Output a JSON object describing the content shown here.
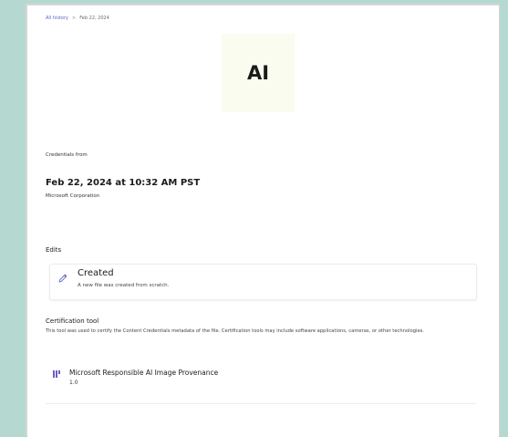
{
  "breadcrumb": {
    "parent": "All history",
    "separator": ">",
    "current": "Feb 22, 2024"
  },
  "thumbnail": {
    "label": "AI"
  },
  "credentials": {
    "heading": "Credentials from",
    "date": "Feb 22, 2024 at 10:32 AM PST",
    "issuer": "Microsoft Corporation"
  },
  "edits": {
    "heading": "Edits",
    "item": {
      "icon": "pencil-icon",
      "title": "Created",
      "description": "A new file was created from scratch."
    }
  },
  "certification": {
    "heading": "Certification tool",
    "description": "This tool was used to certify the Content Credentials metadata of the file. Certification tools may include software applications, cameras, or other technologies.",
    "tool": {
      "icon": "microsoft-tool-icon",
      "name": "Microsoft Responsible AI Image Provenance",
      "version": "1.0"
    }
  },
  "colors": {
    "background": "#b5d9d0",
    "link": "#5a66c8",
    "accent_icon": "#6b5cc8"
  }
}
